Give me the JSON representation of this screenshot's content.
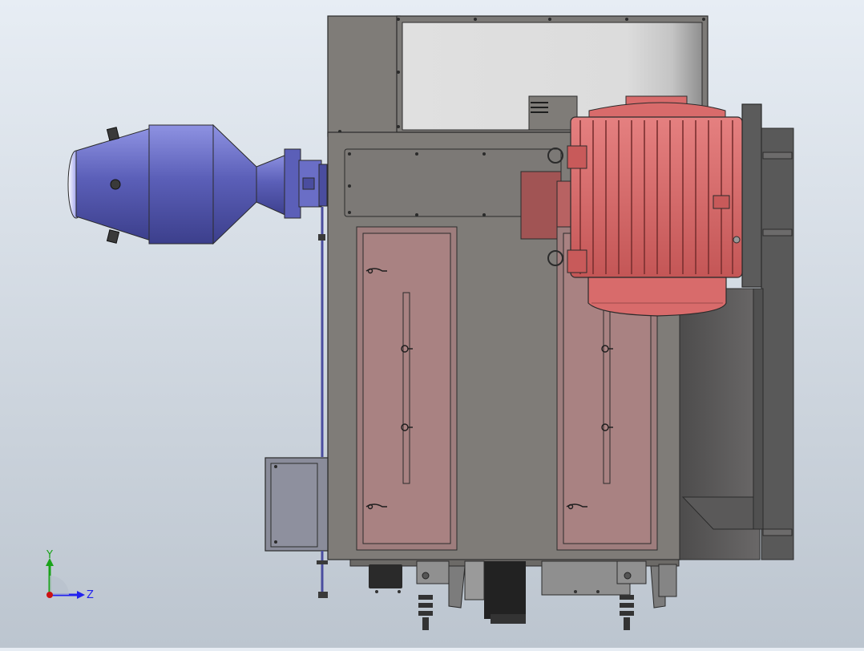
{
  "viewport": {
    "background_top": "#e7edf4",
    "background_bottom": "#bcc5cf"
  },
  "model": {
    "colors": {
      "housing": "#7f7c78",
      "housing_edge": "#2b2b2b",
      "access_door": "#a98282",
      "motor": "#d86b6b",
      "motor_dark": "#b85050",
      "burner": "#5b5fb8",
      "burner_dark": "#45489a",
      "frame": "#595959",
      "window_glass": "#d9d9d9"
    },
    "parts": [
      "upper-housing",
      "window-panel",
      "main-cabinet",
      "access-door-left",
      "access-door-right",
      "electric-motor",
      "motor-mount-plate",
      "side-frame",
      "burner-assembly",
      "control-box",
      "bottom-feet"
    ]
  },
  "triad": {
    "y_label": "Y",
    "z_label": "Z",
    "y_color": "#1aa31a",
    "z_color": "#2222ee",
    "origin_color": "#cc1111"
  }
}
